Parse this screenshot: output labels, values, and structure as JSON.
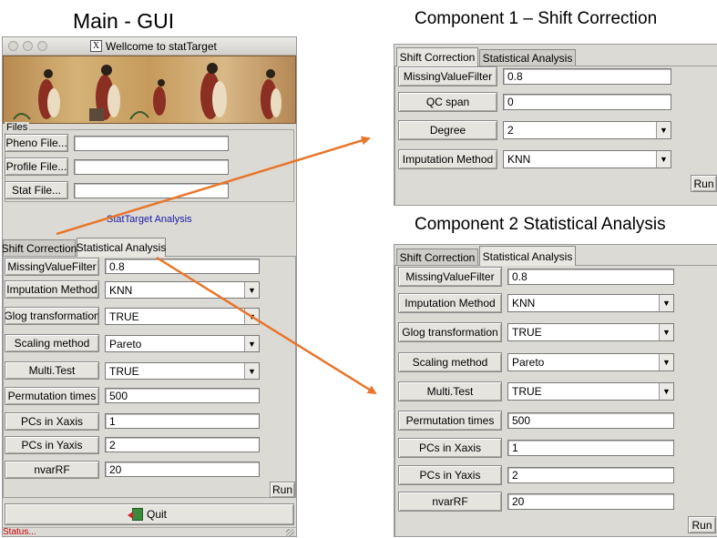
{
  "headings": {
    "main": "Main - GUI",
    "component1": "Component 1 – Shift Correction",
    "component2": "Component 2 Statistical Analysis"
  },
  "window": {
    "title": "Wellcome to statTarget",
    "app_icon": "x11-icon"
  },
  "files": {
    "group_label": "Files",
    "pheno_button": "Pheno File...",
    "pheno_value": "",
    "profile_button": "Profile File...",
    "profile_value": "",
    "stat_button": "Stat File...",
    "stat_value": ""
  },
  "analysis_label": "StatTarget Analysis",
  "tabs": {
    "shift": "Shift Correction",
    "stat": "Statistical Analysis"
  },
  "stat_params": {
    "missing_label": "MissingValueFilter",
    "missing_value": "0.8",
    "imputation_label": "Imputation Method",
    "imputation_value": "KNN",
    "glog_label": "Glog transformation",
    "glog_value": "TRUE",
    "scaling_label": "Scaling method",
    "scaling_value": "Pareto",
    "multitest_label": "Multi.Test",
    "multitest_value": "TRUE",
    "permutation_label": "Permutation times",
    "permutation_value": "500",
    "pcx_label": "PCs in Xaxis",
    "pcx_value": "1",
    "pcy_label": "PCs in Yaxis",
    "pcy_value": "2",
    "nvar_label": "nvarRF",
    "nvar_value": "20",
    "run_label": "Run"
  },
  "shift_params": {
    "missing_label": "MissingValueFilter",
    "missing_value": "0.8",
    "qc_label": "QC span",
    "qc_value": "0",
    "degree_label": "Degree",
    "degree_value": "2",
    "imputation_label": "Imputation Method",
    "imputation_value": "KNN",
    "run_label": "Run"
  },
  "quit_label": "Quit",
  "status_text": "Status...",
  "colors": {
    "arrow": "#e8762b",
    "status": "#cc0000",
    "link": "#1a1aa6",
    "panel": "#dcdad5"
  }
}
